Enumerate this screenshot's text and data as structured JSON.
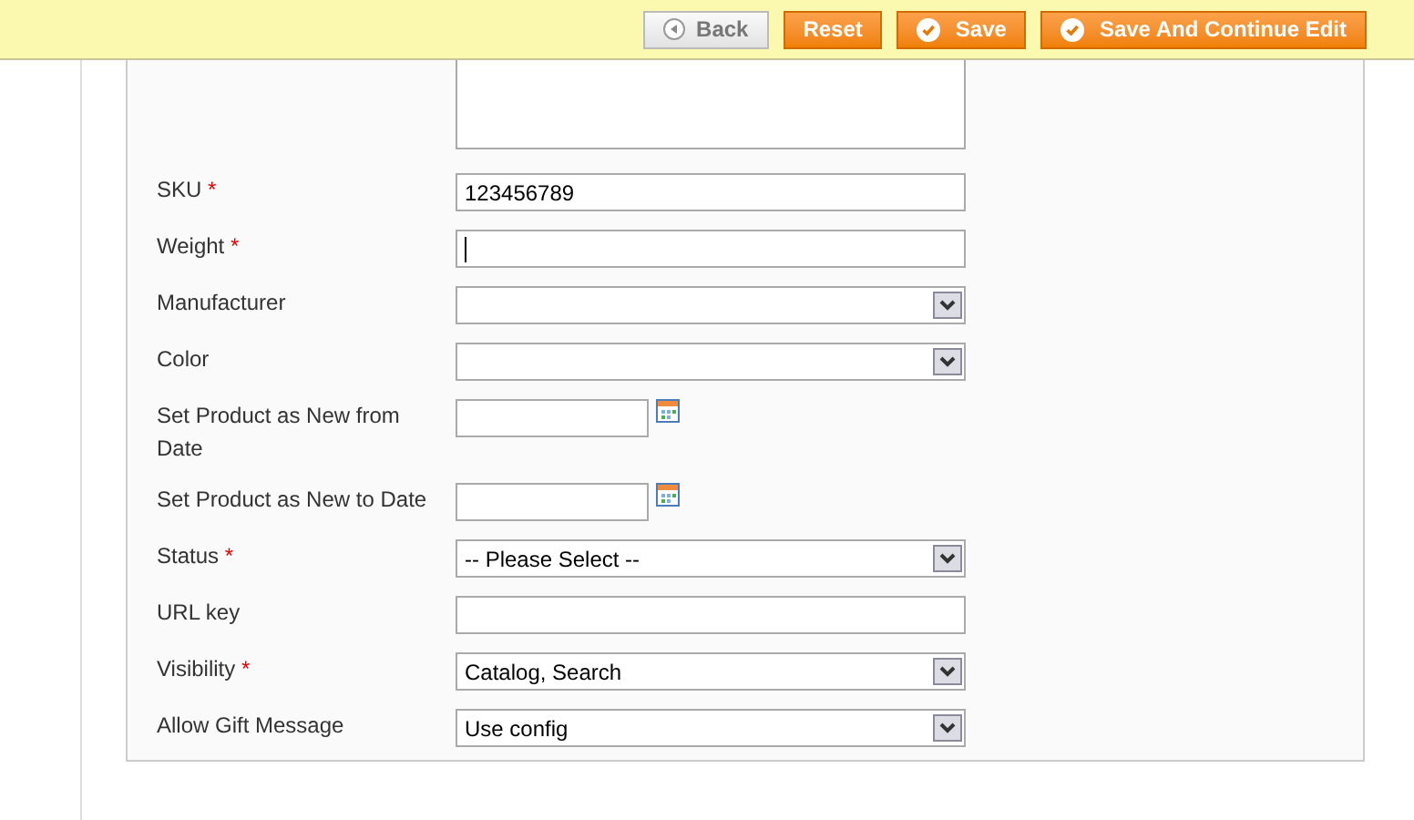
{
  "toolbar": {
    "buttons": [
      {
        "label": "Back",
        "kind": "back"
      },
      {
        "label": "Reset",
        "kind": "plain"
      },
      {
        "label": "Save",
        "kind": "check"
      },
      {
        "label": "Save And Continue Edit",
        "kind": "check"
      }
    ]
  },
  "form": {
    "fields": [
      {
        "kind": "textarea"
      },
      {
        "kind": "text",
        "label": "SKU",
        "required_mark": "*",
        "value": "123456789",
        "focused": false
      },
      {
        "kind": "text",
        "label": "Weight",
        "required_mark": "*",
        "focused": true
      },
      {
        "kind": "select",
        "label": "Manufacturer"
      },
      {
        "kind": "select",
        "label": "Color"
      },
      {
        "kind": "date",
        "label": "Set Product as New from Date"
      },
      {
        "kind": "date",
        "label": "Set Product as New to Date"
      },
      {
        "kind": "select",
        "label": "Status",
        "required_mark": "*",
        "value": "-- Please Select --"
      },
      {
        "kind": "text",
        "label": "URL key",
        "focused": false
      },
      {
        "kind": "select",
        "label": "Visibility",
        "required_mark": "*",
        "value": "Catalog, Search"
      },
      {
        "kind": "select",
        "label": "Allow Gift Message",
        "value": "Use config"
      }
    ]
  }
}
